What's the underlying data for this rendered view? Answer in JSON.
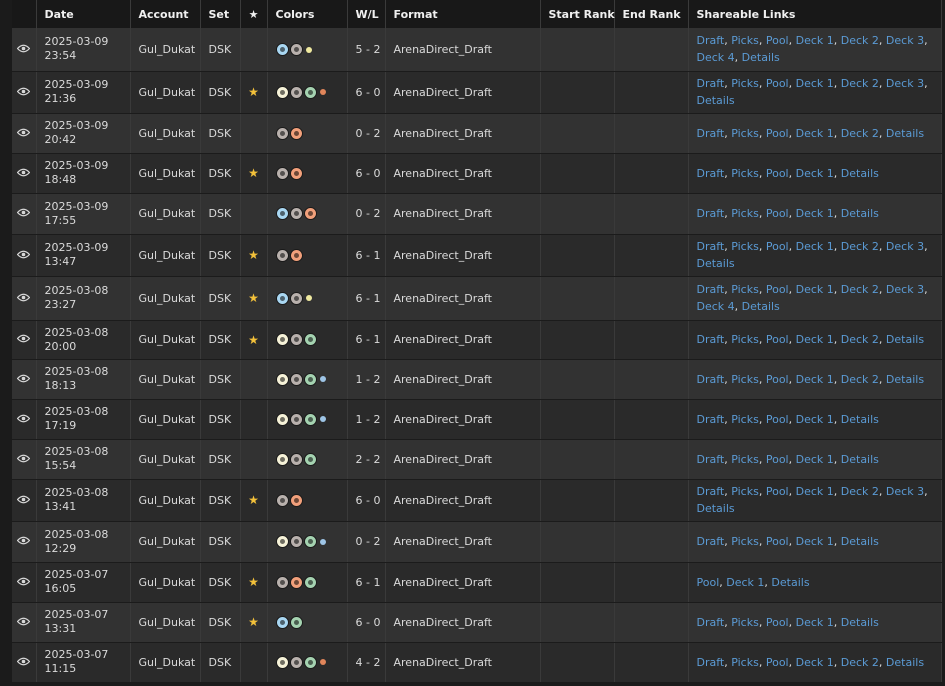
{
  "headers": {
    "date": "Date",
    "account": "Account",
    "set": "Set",
    "star": "★",
    "colors": "Colors",
    "wl": "W/L",
    "format": "Format",
    "start_rank": "Start Rank",
    "end_rank": "End Rank",
    "links": "Shareable Links"
  },
  "colors_map": {
    "W": "#f6f2d8",
    "U": "#a9d7f2",
    "B": "#b9b1ad",
    "R": "#f2a07b",
    "G": "#a5d3b1",
    "yellow": "#f0eaa0",
    "orange": "#e0855a",
    "blue": "#9ec5e6",
    "green": "#8fcf8f"
  },
  "rows": [
    {
      "date": "2025-03-09",
      "time": "23:54",
      "account": "Gul_Dukat",
      "set": "DSK",
      "star": false,
      "colors": [
        "U",
        "B"
      ],
      "dot": "yellow",
      "wl": "5 - 2",
      "format": "ArenaDirect_Draft",
      "links": [
        "Draft",
        "Picks",
        "Pool",
        "Deck 1",
        "Deck 2",
        "Deck 3",
        "Deck 4",
        "Details"
      ]
    },
    {
      "date": "2025-03-09",
      "time": "21:36",
      "account": "Gul_Dukat",
      "set": "DSK",
      "star": true,
      "colors": [
        "W",
        "B",
        "G"
      ],
      "dot": "orange",
      "wl": "6 - 0",
      "format": "ArenaDirect_Draft",
      "links": [
        "Draft",
        "Picks",
        "Pool",
        "Deck 1",
        "Deck 2",
        "Deck 3",
        "Details"
      ]
    },
    {
      "date": "2025-03-09",
      "time": "20:42",
      "account": "Gul_Dukat",
      "set": "DSK",
      "star": false,
      "colors": [
        "B",
        "R"
      ],
      "dot": null,
      "wl": "0 - 2",
      "format": "ArenaDirect_Draft",
      "links": [
        "Draft",
        "Picks",
        "Pool",
        "Deck 1",
        "Deck 2",
        "Details"
      ]
    },
    {
      "date": "2025-03-09",
      "time": "18:48",
      "account": "Gul_Dukat",
      "set": "DSK",
      "star": true,
      "colors": [
        "B",
        "R"
      ],
      "dot": null,
      "wl": "6 - 0",
      "format": "ArenaDirect_Draft",
      "links": [
        "Draft",
        "Picks",
        "Pool",
        "Deck 1",
        "Details"
      ]
    },
    {
      "date": "2025-03-09",
      "time": "17:55",
      "account": "Gul_Dukat",
      "set": "DSK",
      "star": false,
      "colors": [
        "U",
        "B",
        "R"
      ],
      "dot": null,
      "wl": "0 - 2",
      "format": "ArenaDirect_Draft",
      "links": [
        "Draft",
        "Picks",
        "Pool",
        "Deck 1",
        "Details"
      ]
    },
    {
      "date": "2025-03-09",
      "time": "13:47",
      "account": "Gul_Dukat",
      "set": "DSK",
      "star": true,
      "colors": [
        "B",
        "R"
      ],
      "dot": null,
      "wl": "6 - 1",
      "format": "ArenaDirect_Draft",
      "links": [
        "Draft",
        "Picks",
        "Pool",
        "Deck 1",
        "Deck 2",
        "Deck 3",
        "Details"
      ]
    },
    {
      "date": "2025-03-08",
      "time": "23:27",
      "account": "Gul_Dukat",
      "set": "DSK",
      "star": true,
      "colors": [
        "U",
        "B"
      ],
      "dot": "yellow",
      "wl": "6 - 1",
      "format": "ArenaDirect_Draft",
      "links": [
        "Draft",
        "Picks",
        "Pool",
        "Deck 1",
        "Deck 2",
        "Deck 3",
        "Deck 4",
        "Details"
      ]
    },
    {
      "date": "2025-03-08",
      "time": "20:00",
      "account": "Gul_Dukat",
      "set": "DSK",
      "star": true,
      "colors": [
        "W",
        "B",
        "G"
      ],
      "dot": null,
      "wl": "6 - 1",
      "format": "ArenaDirect_Draft",
      "links": [
        "Draft",
        "Picks",
        "Pool",
        "Deck 1",
        "Deck 2",
        "Details"
      ]
    },
    {
      "date": "2025-03-08",
      "time": "18:13",
      "account": "Gul_Dukat",
      "set": "DSK",
      "star": false,
      "colors": [
        "W",
        "B",
        "G"
      ],
      "dot": "blue",
      "wl": "1 - 2",
      "format": "ArenaDirect_Draft",
      "links": [
        "Draft",
        "Picks",
        "Pool",
        "Deck 1",
        "Deck 2",
        "Details"
      ]
    },
    {
      "date": "2025-03-08",
      "time": "17:19",
      "account": "Gul_Dukat",
      "set": "DSK",
      "star": false,
      "colors": [
        "W",
        "B",
        "G"
      ],
      "dot": "blue",
      "wl": "1 - 2",
      "format": "ArenaDirect_Draft",
      "links": [
        "Draft",
        "Picks",
        "Pool",
        "Deck 1",
        "Details"
      ]
    },
    {
      "date": "2025-03-08",
      "time": "15:54",
      "account": "Gul_Dukat",
      "set": "DSK",
      "star": false,
      "colors": [
        "W",
        "B",
        "G"
      ],
      "dot": null,
      "wl": "2 - 2",
      "format": "ArenaDirect_Draft",
      "links": [
        "Draft",
        "Picks",
        "Pool",
        "Deck 1",
        "Details"
      ]
    },
    {
      "date": "2025-03-08",
      "time": "13:41",
      "account": "Gul_Dukat",
      "set": "DSK",
      "star": true,
      "colors": [
        "B",
        "R"
      ],
      "dot": null,
      "wl": "6 - 0",
      "format": "ArenaDirect_Draft",
      "links": [
        "Draft",
        "Picks",
        "Pool",
        "Deck 1",
        "Deck 2",
        "Deck 3",
        "Details"
      ]
    },
    {
      "date": "2025-03-08",
      "time": "12:29",
      "account": "Gul_Dukat",
      "set": "DSK",
      "star": false,
      "colors": [
        "W",
        "B",
        "G"
      ],
      "dot": "blue",
      "wl": "0 - 2",
      "format": "ArenaDirect_Draft",
      "links": [
        "Draft",
        "Picks",
        "Pool",
        "Deck 1",
        "Details"
      ]
    },
    {
      "date": "2025-03-07",
      "time": "16:05",
      "account": "Gul_Dukat",
      "set": "DSK",
      "star": true,
      "colors": [
        "B",
        "R",
        "G"
      ],
      "dot": null,
      "wl": "6 - 1",
      "format": "ArenaDirect_Draft",
      "links": [
        "Pool",
        "Deck 1",
        "Details"
      ]
    },
    {
      "date": "2025-03-07",
      "time": "13:31",
      "account": "Gul_Dukat",
      "set": "DSK",
      "star": true,
      "colors": [
        "U",
        "G"
      ],
      "dot": null,
      "wl": "6 - 0",
      "format": "ArenaDirect_Draft",
      "links": [
        "Draft",
        "Picks",
        "Pool",
        "Deck 1",
        "Details"
      ]
    },
    {
      "date": "2025-03-07",
      "time": "11:15",
      "account": "Gul_Dukat",
      "set": "DSK",
      "star": false,
      "colors": [
        "W",
        "B",
        "G"
      ],
      "dot": "orange",
      "wl": "4 - 2",
      "format": "ArenaDirect_Draft",
      "links": [
        "Draft",
        "Picks",
        "Pool",
        "Deck 1",
        "Deck 2",
        "Details"
      ]
    }
  ]
}
